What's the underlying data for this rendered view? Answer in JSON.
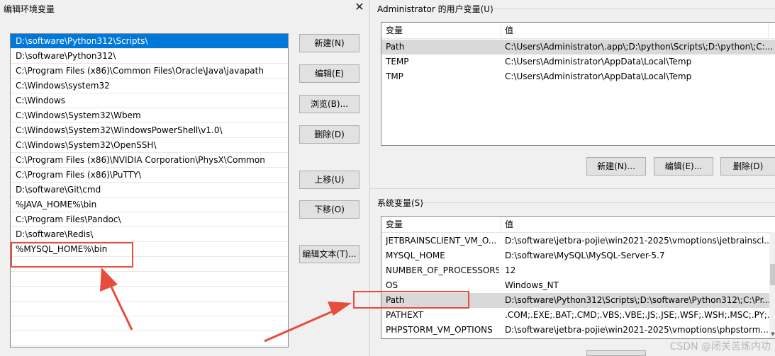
{
  "left_dialog": {
    "title": "编辑环境变量",
    "close_glyph": "✕",
    "paths": [
      "D:\\software\\Python312\\Scripts\\",
      "D:\\software\\Python312\\",
      "C:\\Program Files (x86)\\Common Files\\Oracle\\Java\\javapath",
      "C:\\Windows\\system32",
      "C:\\Windows",
      "C:\\Windows\\System32\\Wbem",
      "C:\\Windows\\System32\\WindowsPowerShell\\v1.0\\",
      "C:\\Windows\\System32\\OpenSSH\\",
      "C:\\Program Files (x86)\\NVIDIA Corporation\\PhysX\\Common",
      "C:\\Program Files (x86)\\PuTTY\\",
      "D:\\software\\Git\\cmd",
      "%JAVA_HOME%\\bin",
      "C:\\Program Files\\Pandoc\\",
      "D:\\software\\Redis\\",
      "%MYSQL_HOME%\\bin"
    ],
    "buttons": {
      "new": "新建(N)",
      "edit": "编辑(E)",
      "browse": "浏览(B)...",
      "delete": "删除(D)",
      "move_up": "上移(U)",
      "move_down": "下移(O)",
      "edit_text": "编辑文本(T)..."
    }
  },
  "right_dialog": {
    "user_group_label": "Administrator 的用户变量(U)",
    "sys_group_label": "系统变量(S)",
    "col_var": "变量",
    "col_val": "值",
    "user_vars": [
      {
        "name": "Path",
        "value": "C:\\Users\\Administrator\\.app\\;D:\\python\\Scripts\\;D:\\python\\;C:..."
      },
      {
        "name": "TEMP",
        "value": "C:\\Users\\Administrator\\AppData\\Local\\Temp"
      },
      {
        "name": "TMP",
        "value": "C:\\Users\\Administrator\\AppData\\Local\\Temp"
      }
    ],
    "user_buttons": {
      "new": "新建(N)...",
      "edit": "编辑(E)...",
      "delete": "删除(D)"
    },
    "sys_vars": [
      {
        "name": "JETBRAINSCLIENT_VM_O...",
        "value": "D:\\software\\jetbra-pojie\\win2021-2025\\vmoptions\\jetbrainscl..."
      },
      {
        "name": "MYSQL_HOME",
        "value": "D:\\software\\MySQL\\MySQL-Server-5.7"
      },
      {
        "name": "NUMBER_OF_PROCESSORS",
        "value": "12"
      },
      {
        "name": "OS",
        "value": "Windows_NT"
      },
      {
        "name": "Path",
        "value": "D:\\software\\Python312\\Scripts\\;D:\\software\\Python312\\;C:\\Pr..."
      },
      {
        "name": "PATHEXT",
        "value": ".COM;.EXE;.BAT;.CMD;.VBS;.VBE;.JS;.JSE;.WSF;.WSH;.MSC;.PY;.P..."
      },
      {
        "name": "PHPSTORM_VM_OPTIONS",
        "value": "D:\\software\\jetbra-pojie\\win2021-2025\\vmoptions\\phpstorm...."
      }
    ]
  },
  "watermark": "CSDN @闭关苦炼内功",
  "colors": {
    "selection": "#0078d7",
    "annotation": "#e74c3c"
  }
}
